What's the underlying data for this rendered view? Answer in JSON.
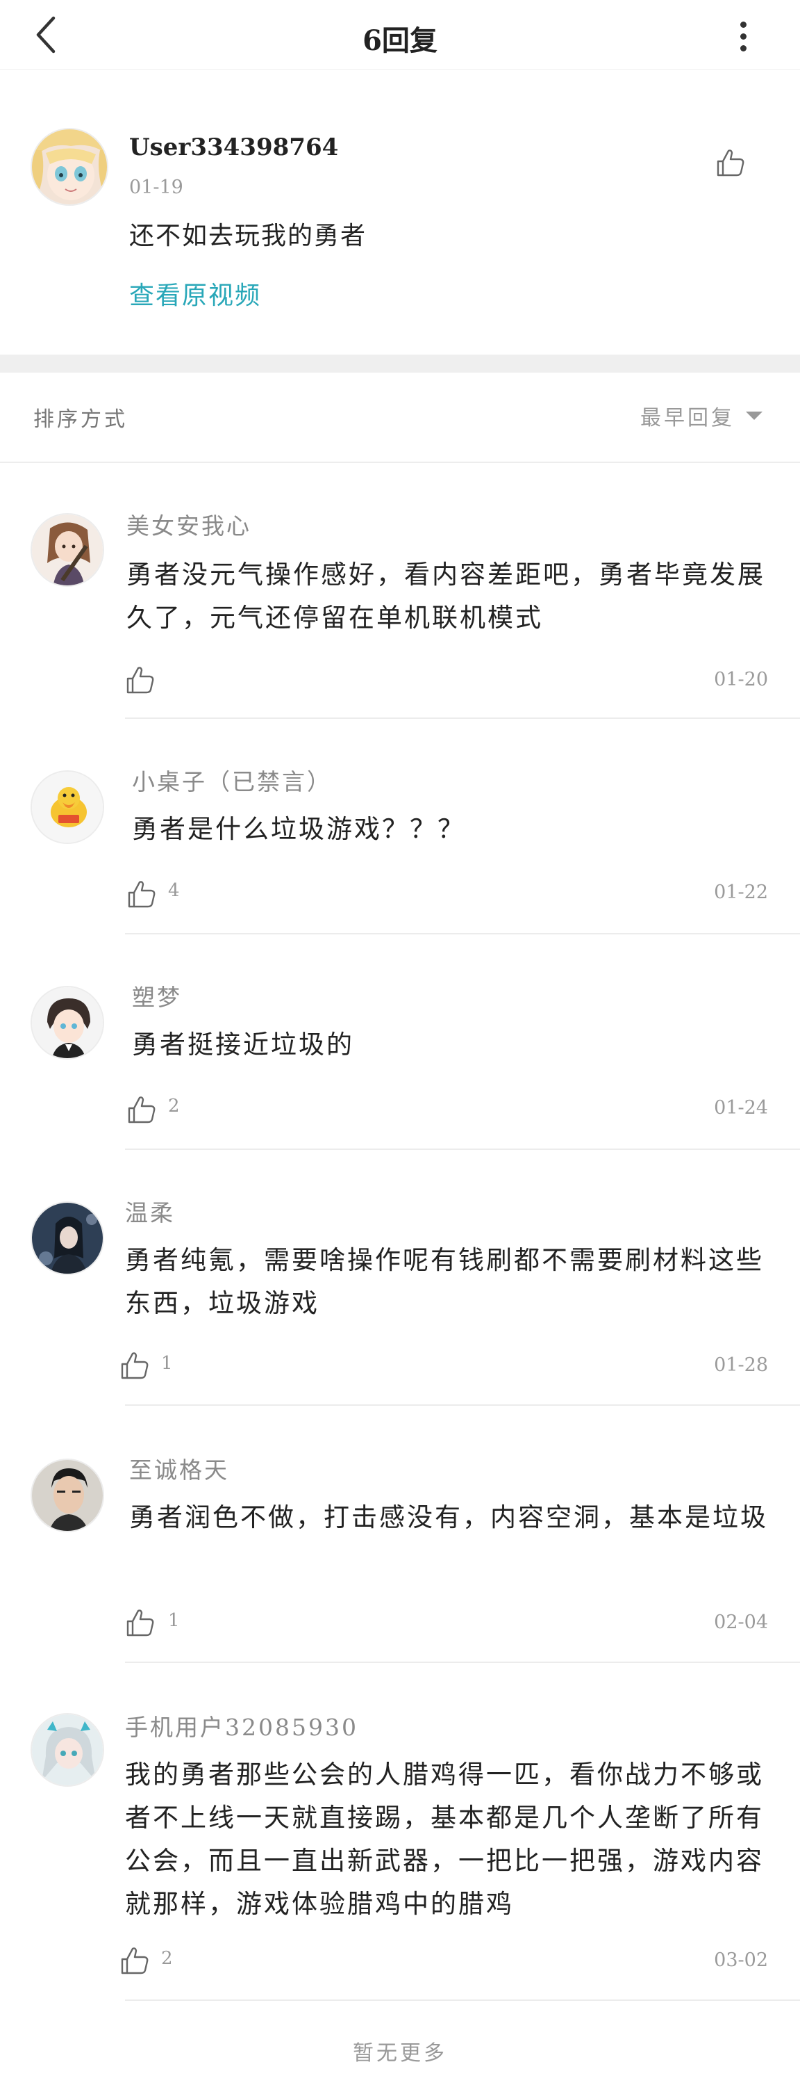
{
  "header": {
    "title": "6回复"
  },
  "original_post": {
    "user": "User334398764",
    "date": "01-19",
    "text": "还不如去玩我的勇者",
    "link": "查看原视频"
  },
  "sort": {
    "label": "排序方式",
    "value": "最早回复"
  },
  "replies": [
    {
      "user": "美女安我心",
      "text": "勇者没元气操作感好，看内容差距吧，勇者毕竟发展久了，元气还停留在单机联机模式",
      "likes": "",
      "date": "01-20"
    },
    {
      "user": "小桌子（已禁言）",
      "text": "勇者是什么垃圾游戏？？？",
      "likes": "4",
      "date": "01-22"
    },
    {
      "user": "塑梦",
      "text": "勇者挺接近垃圾的",
      "likes": "2",
      "date": "01-24"
    },
    {
      "user": "温柔",
      "text": "勇者纯氪，需要啥操作呢有钱刷都不需要刷材料这些东西，垃圾游戏",
      "likes": "1",
      "date": "01-28"
    },
    {
      "user": "至诚格天",
      "text": "勇者润色不做，打击感没有，内容空洞，基本是垃圾",
      "likes": "1",
      "date": "02-04"
    },
    {
      "user": "手机用户32085930",
      "text": "我的勇者那些公会的人腊鸡得一匹，看你战力不够或者不上线一天就直接踢，基本都是几个人垄断了所有公会，而且一直出新武器，一把比一把强，游戏内容就那样，游戏体验腊鸡中的腊鸡",
      "likes": "2",
      "date": "03-02"
    }
  ],
  "footer": {
    "text": "暂无更多"
  },
  "colors": {
    "accent_link": "#28a7b8",
    "divider": "#efefef",
    "muted_text": "#9a9a9a"
  },
  "icons": {
    "back": "chevron-left-icon",
    "more": "more-vertical-icon",
    "like": "thumbs-up-icon",
    "sort_caret": "caret-down-icon"
  }
}
